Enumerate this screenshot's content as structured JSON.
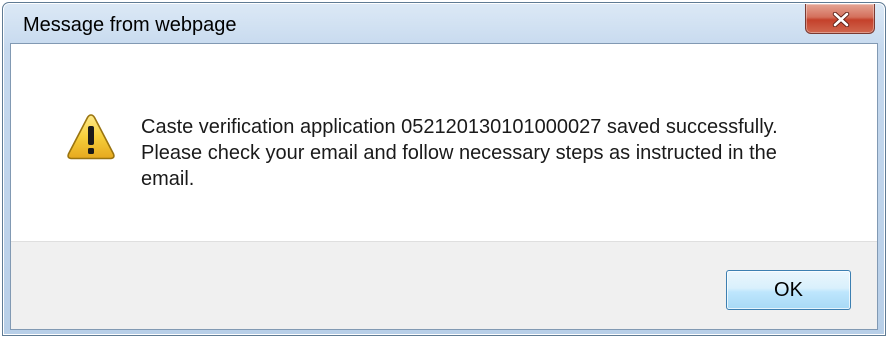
{
  "dialog": {
    "title": "Message from webpage",
    "close_icon": "close-icon",
    "icon": "warning-icon",
    "message_lines": [
      "Caste verification application 052120130101000027 saved successfully.",
      "Please check your email and follow  necessary steps as instructed in the",
      "email."
    ],
    "ok_label": "OK"
  },
  "colors": {
    "title_bar": "#c6d9ee",
    "close_button": "#c4412b",
    "footer": "#f0f0f0",
    "ok_button_border": "#3c7fb1",
    "warning_fill": "#f4c430"
  }
}
